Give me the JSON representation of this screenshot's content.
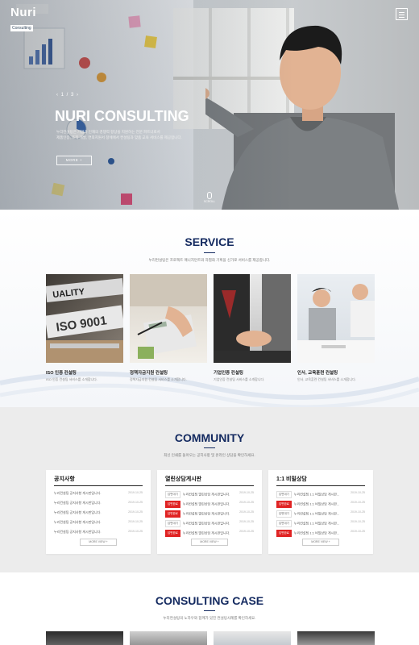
{
  "header": {
    "logo_main": "Nuri",
    "logo_sub": "Consulting",
    "menu_icon": "hamburger-icon"
  },
  "hero": {
    "slide_counter": "‹ 1 / 3 ›",
    "title": "NURI CONSULTING",
    "desc_line1": "누리컨설팅은 기업과 인재의 경쟁력 향상을 지원하는 전문 파트너로서",
    "desc_line2": "제품인증, 조직 개발, 연최지원서 창에에서 컨설팅과 맞춤 교육 서비스를 제공합니다.",
    "more_label": "MORE +",
    "scroll_label": "SCROLL"
  },
  "service": {
    "title": "SERVICE",
    "subtitle": "누리컨설팅은 프로젝트 매니지먼트와 차별화 기획을 신가로 서비스를 제공합니다.",
    "cards": [
      {
        "title": "ISO 인증 컨설팅",
        "desc": "ISO 인증 컨설팅 서비스를 소개합니다."
      },
      {
        "title": "정책자금지원 컨설팅",
        "desc": "정책자금지원 컨설팅 서비스를 소개합니다."
      },
      {
        "title": "기업인증 컨설팅",
        "desc": "기업인증 컨설팅 서비스를 소개합니다."
      },
      {
        "title": "인사, 교육훈련 컨설팅",
        "desc": "인사, 교육훈련 컨설팅 서비스를 소개합니다."
      }
    ]
  },
  "community": {
    "title": "COMMUNITY",
    "subtitle": "최신 인쇄를 돌아오는 공지사항 및 온라인 상담을 확인하세요.",
    "more_label": "MORE VIEW +",
    "boxes": [
      {
        "title": "공지사항",
        "rows": [
          {
            "badge": "",
            "text": "누리컨설팅 공지사항 게시판입니다.",
            "date": "2019-10-25"
          },
          {
            "badge": "",
            "text": "누리컨설팅 공지사항 게시판입니다.",
            "date": "2019-10-25"
          },
          {
            "badge": "",
            "text": "누리컨설팅 공지사항 게시판입니다.",
            "date": "2019-10-25"
          },
          {
            "badge": "",
            "text": "누리컨설팅 공지사항 게시판입니다.",
            "date": "2019-10-25"
          },
          {
            "badge": "",
            "text": "누리컨설팅 공지사항 게시판입니다.",
            "date": "2019-10-25"
          }
        ]
      },
      {
        "title": "열린상담게시판",
        "rows": [
          {
            "badge": "답변대기",
            "text": "누리컨설팅 열린상담 게시판입니다.",
            "date": "2019-10-25"
          },
          {
            "badge": "답변완료",
            "text": "누리컨설팅 열린상담 게시판입니다.",
            "date": "2019-10-25"
          },
          {
            "badge": "답변완료",
            "text": "누리컨설팅 열린상담 게시판입니다.",
            "date": "2019-10-25"
          },
          {
            "badge": "답변대기",
            "text": "누리컨설팅 열린상담 게시판입니다.",
            "date": "2019-10-25"
          },
          {
            "badge": "답변완료",
            "text": "누리컨설팅 열린상담 게시판입니다.",
            "date": "2019-10-25"
          }
        ]
      },
      {
        "title": "1:1 비밀상담",
        "rows": [
          {
            "badge": "답변대기",
            "text": "누리컨설팅 1:1 비밀상담 게시판...",
            "date": "2019-10-25"
          },
          {
            "badge": "답변완료",
            "text": "누리컨설팅 1:1 비밀상담 게시판...",
            "date": "2019-10-25"
          },
          {
            "badge": "답변대기",
            "text": "누리컨설팅 1:1 비밀상담 게시판...",
            "date": "2019-10-25"
          },
          {
            "badge": "답변대기",
            "text": "누리컨설팅 1:1 비밀상담 게시판...",
            "date": "2019-10-25"
          },
          {
            "badge": "답변완료",
            "text": "누리컨설팅 1:1 비밀상담 게시판...",
            "date": "2019-10-25"
          }
        ]
      }
    ]
  },
  "case": {
    "title": "CONSULTING CASE",
    "subtitle": "누리컨설팅의 노하우와 함께가 있진 컨설팅사례를 확인하세요."
  },
  "colors": {
    "navy": "#142a60",
    "badge_red": "#e02323"
  }
}
